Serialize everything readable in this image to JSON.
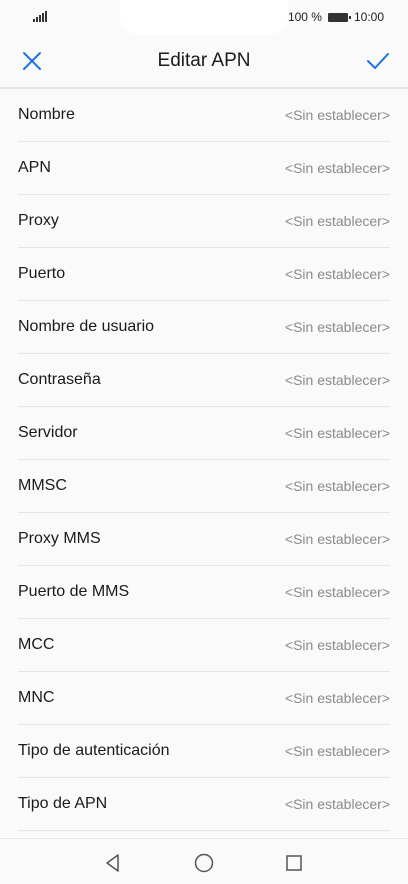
{
  "status_bar": {
    "battery_percent": "100 %",
    "time": "10:00",
    "icons": [
      "signal-icon",
      "battery-icon"
    ]
  },
  "header": {
    "title": "Editar APN",
    "close_icon": "close-icon",
    "confirm_icon": "checkmark-icon",
    "accent_color": "#1a73e8"
  },
  "fields": [
    {
      "label": "Nombre",
      "value": "<Sin establecer>"
    },
    {
      "label": "APN",
      "value": "<Sin establecer>"
    },
    {
      "label": "Proxy",
      "value": "<Sin establecer>"
    },
    {
      "label": "Puerto",
      "value": "<Sin establecer>"
    },
    {
      "label": "Nombre de usuario",
      "value": "<Sin establecer>"
    },
    {
      "label": "Contraseña",
      "value": "<Sin establecer>"
    },
    {
      "label": "Servidor",
      "value": "<Sin establecer>"
    },
    {
      "label": "MMSC",
      "value": "<Sin establecer>"
    },
    {
      "label": "Proxy MMS",
      "value": "<Sin establecer>"
    },
    {
      "label": "Puerto de MMS",
      "value": "<Sin establecer>"
    },
    {
      "label": "MCC",
      "value": "<Sin establecer>"
    },
    {
      "label": "MNC",
      "value": "<Sin establecer>"
    },
    {
      "label": "Tipo de autenticación",
      "value": "<Sin establecer>"
    },
    {
      "label": "Tipo de APN",
      "value": "<Sin establecer>"
    }
  ],
  "nav_bar": {
    "icons": [
      "back-triangle-icon",
      "home-circle-icon",
      "recents-square-icon"
    ]
  }
}
